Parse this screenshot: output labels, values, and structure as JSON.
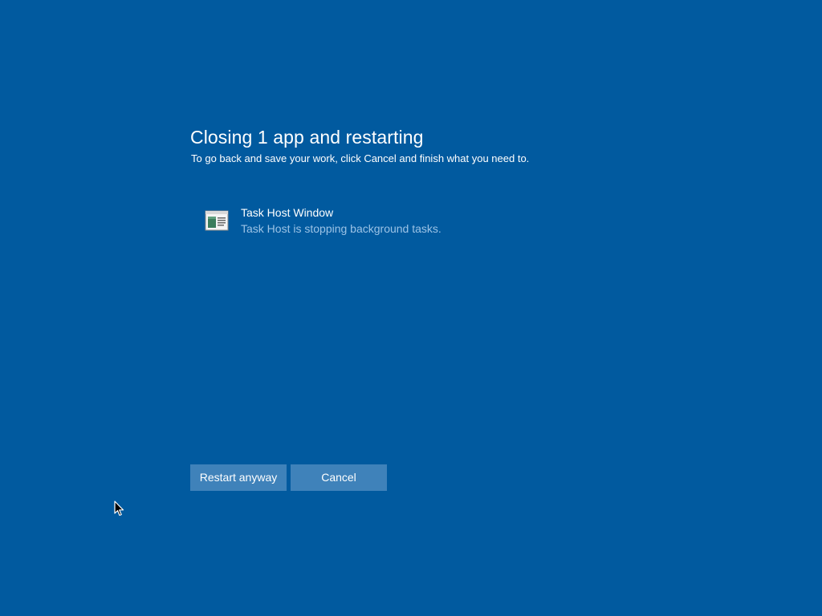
{
  "dialog": {
    "title": "Closing 1 app and restarting",
    "subtitle": "To go back and save your work, click Cancel and finish what you need to."
  },
  "apps": [
    {
      "name": "Task Host Window",
      "status": "Task Host is stopping background tasks.",
      "icon": "window-app-icon"
    }
  ],
  "buttons": {
    "restart_label": "Restart anyway",
    "cancel_label": "Cancel"
  },
  "colors": {
    "background": "#015a9f",
    "button": "#3f82ba",
    "status_text": "#9cc3e6"
  },
  "cursor": {
    "icon": "mouse-pointer-icon"
  }
}
